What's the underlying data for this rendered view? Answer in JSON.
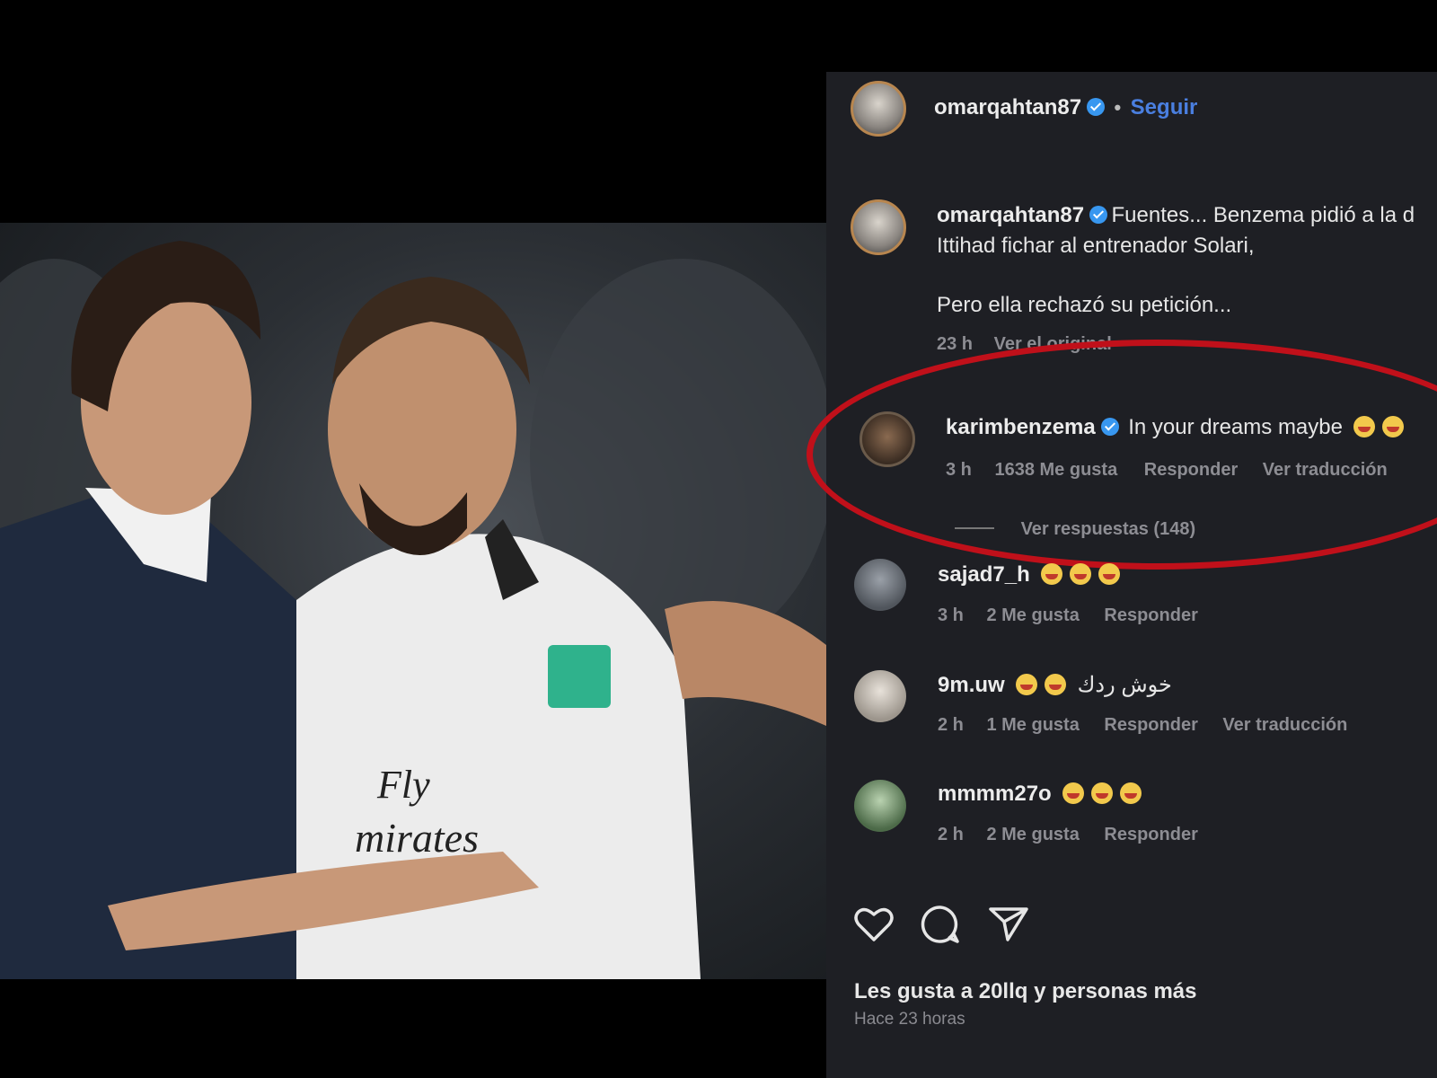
{
  "header": {
    "username": "omarqahtan87",
    "separator": "•",
    "follow_label": "Seguir"
  },
  "caption": {
    "username": "omarqahtan87",
    "text_line1": "Fuentes... Benzema pidió a la d",
    "text_line2": "Ittihad fichar al entrenador Solari,",
    "text_line3": "Pero ella rechazó su petición...",
    "time": "23 h",
    "see_translation": "Ver el original"
  },
  "comments": [
    {
      "username": "karimbenzema",
      "verified": true,
      "text": "In your dreams maybe",
      "emoji_count": 2,
      "time": "3 h",
      "likes": "1638 Me gusta",
      "reply": "Responder",
      "translate": "Ver traducción",
      "view_replies": "Ver respuestas (148)"
    },
    {
      "username": "sajad7_h",
      "text": "",
      "emoji_count": 3,
      "time": "3 h",
      "likes": "2 Me gusta",
      "reply": "Responder"
    },
    {
      "username": "9m.uw",
      "text": "خوش ردك",
      "emoji_count": 2,
      "time": "2 h",
      "likes": "1 Me gusta",
      "reply": "Responder",
      "translate": "Ver traducción"
    },
    {
      "username": "mmmm27o",
      "text": "",
      "emoji_count": 3,
      "time": "2 h",
      "likes": "2 Me gusta",
      "reply": "Responder"
    }
  ],
  "footer": {
    "likes_text": "Les gusta a 20llq y personas más",
    "time_ago": "Hace 23 horas"
  },
  "icons": [
    "heart-icon",
    "comment-icon",
    "share-icon",
    "verified-icon"
  ],
  "colors": {
    "panel_bg": "#1e1f24",
    "accent_blue": "#4a7fe0",
    "highlight_red": "#c0101a"
  }
}
